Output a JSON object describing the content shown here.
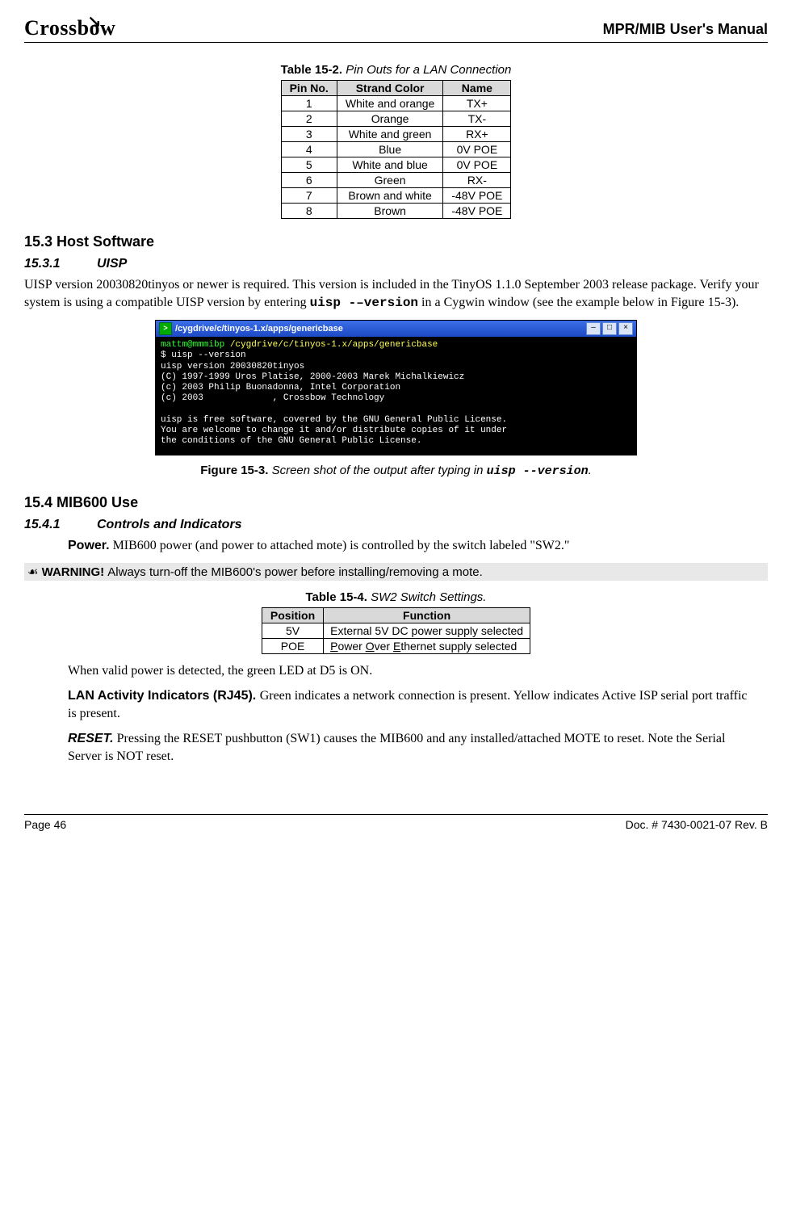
{
  "header": {
    "logo_text": "Crossbow",
    "doc_title": "MPR/MIB User's Manual"
  },
  "table_15_2": {
    "caption_bold": "Table 15-2.",
    "caption_ital": " Pin Outs for a LAN Connection",
    "headers": [
      "Pin No.",
      "Strand Color",
      "Name"
    ],
    "rows": [
      [
        "1",
        "White and orange",
        "TX+"
      ],
      [
        "2",
        "Orange",
        "TX-"
      ],
      [
        "3",
        "White and green",
        "RX+"
      ],
      [
        "4",
        "Blue",
        "0V POE"
      ],
      [
        "5",
        "White and blue",
        "0V POE"
      ],
      [
        "6",
        "Green",
        "RX-"
      ],
      [
        "7",
        "Brown and white",
        "-48V POE"
      ],
      [
        "8",
        "Brown",
        "-48V POE"
      ]
    ]
  },
  "sect_15_3": {
    "heading": "15.3    Host Software",
    "sub_15_3_1_num": "15.3.1",
    "sub_15_3_1_title": "UISP",
    "para_before_cmd": "UISP version 20030820tinyos or newer is required. This version is included in the TinyOS 1.1.0 September 2003 release package. Verify your system is using a compatible UISP version by entering ",
    "cmd": "uisp -–version",
    "para_after_cmd": " in a Cygwin window (see the example below in Figure 15-3)."
  },
  "terminal": {
    "title": "/cygdrive/c/tinyos-1.x/apps/genericbase",
    "prompt_user": "mattm@mmmibp ",
    "prompt_path": "/cygdrive/c/tinyos-1.x/apps/genericbase",
    "line2": "$ uisp --version",
    "line3": "uisp version 20030820tinyos",
    "line4": "(C) 1997-1999 Uros Platise, 2000-2003 Marek Michalkiewicz",
    "line5": "(c) 2003 Philip Buonadonna, Intel Corporation",
    "line6": "(c) 2003             , Crossbow Technology",
    "blank": "",
    "line7": "uisp is free software, covered by the GNU General Public License.",
    "line8": "You are welcome to change it and/or distribute copies of it under",
    "line9": "the conditions of the GNU General Public License."
  },
  "figure_15_3": {
    "bold": "Figure 15-3.",
    "ital": " Screen shot of the output after typing in ",
    "mono": "uisp --version",
    "tail": "."
  },
  "sect_15_4": {
    "heading": "15.4    MIB600 Use",
    "sub_15_4_1_num": "15.4.1",
    "sub_15_4_1_title": "Controls and Indicators",
    "power_label": "Power.",
    "power_text": " MIB600 power (and power to attached mote) is controlled by the switch labeled \"SW2.\"",
    "warning_icon": "☙",
    "warning_label": " WARNING!  ",
    "warning_text": "Always turn-off the MIB600's power before installing/removing a mote."
  },
  "table_15_4": {
    "caption_bold": "Table 15-4.",
    "caption_ital": " SW2 Switch Settings.",
    "headers": [
      "Position",
      "Function"
    ],
    "rows": [
      [
        "5V",
        "External 5V DC power supply selected"
      ],
      [
        "POE",
        "Power Over Ethernet supply selected"
      ]
    ]
  },
  "after_table": {
    "para1": "When valid power is detected, the green LED at D5 is ON.",
    "lan_label": "LAN Activity Indicators (RJ45). ",
    "lan_text": "Green indicates a network connection is present. Yellow indicates Active ISP serial port traffic is present.",
    "reset_label": "RESET.",
    "reset_text": " Pressing the RESET pushbutton (SW1) causes the MIB600 and any installed/attached MOTE to reset. Note the Serial Server is NOT reset."
  },
  "footer": {
    "left": "Page 46",
    "right": "Doc. # 7430-0021-07 Rev. B"
  }
}
